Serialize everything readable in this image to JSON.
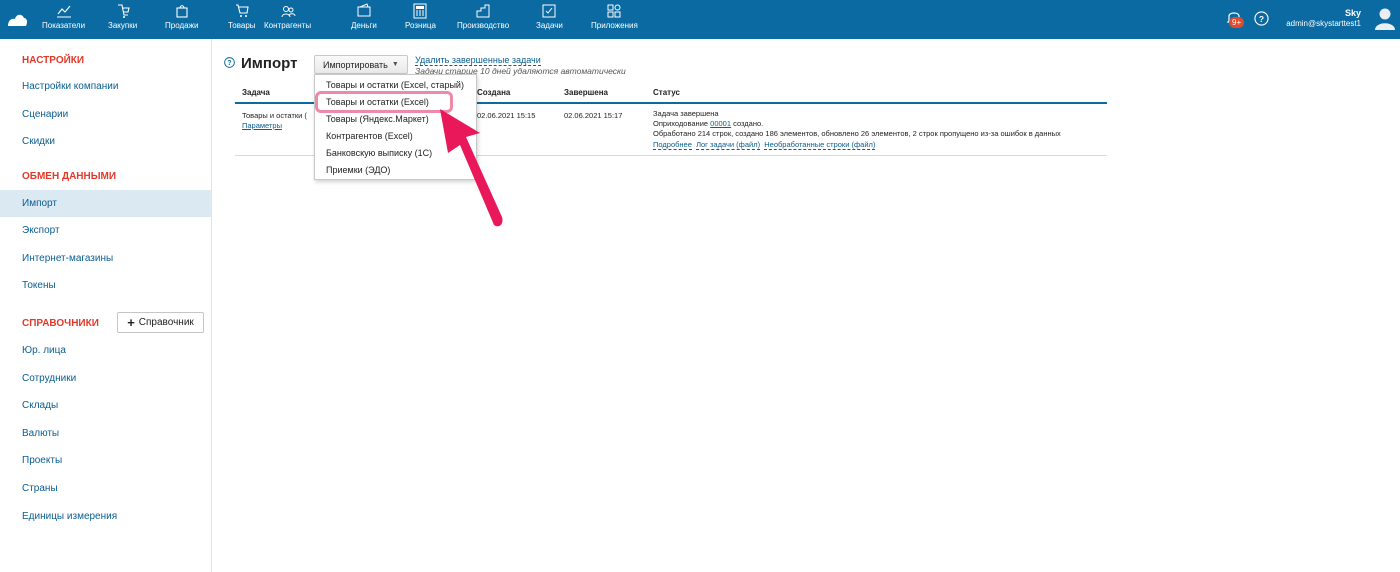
{
  "topnav": {
    "items": [
      {
        "label": "Показатели",
        "icon": "chart-icon"
      },
      {
        "label": "Закупки",
        "icon": "purchase-icon"
      },
      {
        "label": "Продажи",
        "icon": "bag-icon"
      },
      {
        "label": "Товары",
        "icon": "cart-icon"
      },
      {
        "label": "Контрагенты",
        "icon": "people-icon"
      },
      {
        "label": "Деньги",
        "icon": "wallet-icon"
      },
      {
        "label": "Розница",
        "icon": "register-icon"
      },
      {
        "label": "Производство",
        "icon": "factory-icon"
      },
      {
        "label": "Задачи",
        "icon": "tasks-icon"
      },
      {
        "label": "Приложения",
        "icon": "apps-icon"
      }
    ],
    "notification_badge": "9+",
    "user_name": "Sky",
    "user_email": "admin@skystarttest1"
  },
  "sidebar": {
    "section_settings": "НАСТРОЙКИ",
    "settings_items": [
      "Настройки компании",
      "Сценарии",
      "Скидки"
    ],
    "section_exchange": "ОБМЕН ДАННЫМИ",
    "exchange_items": [
      "Импорт",
      "Экспорт",
      "Интернет-магазины",
      "Токены"
    ],
    "section_refs": "СПРАВОЧНИКИ",
    "ref_button": "Справочник",
    "ref_items": [
      "Юр. лица",
      "Сотрудники",
      "Склады",
      "Валюты",
      "Проекты",
      "Страны",
      "Единицы измерения"
    ]
  },
  "main": {
    "title": "Импорт",
    "import_button": "Импортировать",
    "delete_link": "Удалить завершенные задачи",
    "delete_note": "Задачи старше 10 дней удаляются автоматически",
    "columns": [
      "Задача",
      "Создана",
      "Завершена",
      "Статус"
    ],
    "row": {
      "task": "Товары и остатки (",
      "params_link": "Параметры",
      "created": "02.06.2021 15:15",
      "finished": "02.06.2021 15:17",
      "status_line1": "Задача завершена",
      "status_line2_prefix": "Оприходование",
      "status_line2_link": "00001",
      "status_line2_suffix": "создано.",
      "status_line3": "Обработано 214 строк, создано 186 элементов, обновлено 26 элементов, 2 строк пропущено из-за ошибок в данных",
      "link_details": "Подробнее",
      "link_log": "Лог задачи (файл)",
      "link_unprocessed": "Необработанные строки (файл)"
    },
    "dropdown": [
      "Товары и остатки (Excel, старый)",
      "Товары и остатки (Excel)",
      "Товары (Яндекс.Маркет)",
      "Контрагентов (Excel)",
      "Банковскую выписку (1С)",
      "Приемки (ЭДО)"
    ]
  },
  "colors": {
    "topbar": "#0a6aa1",
    "section_header": "#e13a2b",
    "link": "#0a5d90",
    "active_bg": "#dbe9f3",
    "highlight": "#ee8aa8",
    "arrow": "#e8185a"
  }
}
